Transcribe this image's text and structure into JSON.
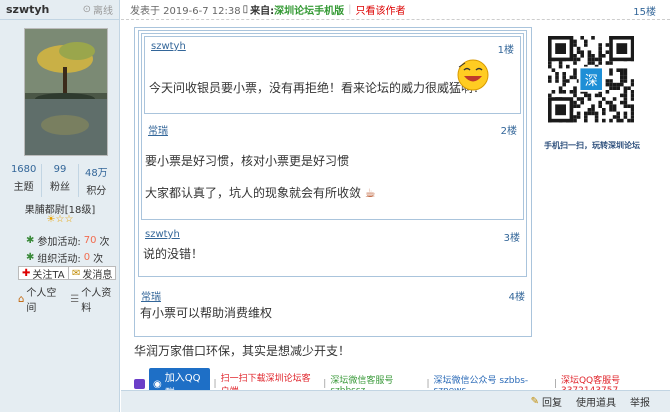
{
  "user": {
    "name": "szwtyh",
    "status": "离线",
    "stats": [
      {
        "value": "1680",
        "label": "主题"
      },
      {
        "value": "99",
        "label": "粉丝"
      },
      {
        "value": "48万",
        "label": "积分"
      }
    ],
    "rank": "果脯都尉[18级]",
    "activities": [
      {
        "prefix": "参加活动:",
        "count": "70",
        "suffix": "次"
      },
      {
        "prefix": "组织活动:",
        "count": "0",
        "suffix": "次"
      }
    ],
    "follow_label": "关注TA",
    "message_label": "发消息",
    "space_label": "个人空间",
    "profile_label": "个人资料"
  },
  "post_header": {
    "posted": "发表于 2019-6-7 12:38",
    "from_label": "来自:",
    "from_source": "深圳论坛手机版",
    "only_author": "只看该作者",
    "floor": "15楼"
  },
  "quotes": [
    {
      "user": "szwtyh",
      "floor": "1楼",
      "lines": [
        "今天问收银员要小票，没有再拒绝！看来论坛的威力很威猛啊！"
      ]
    },
    {
      "user": "常瑞",
      "floor": "2楼",
      "lines": [
        "要小票是好习惯，核对小票更是好习惯",
        "大家都认真了，坑人的现象就会有所收敛"
      ]
    },
    {
      "user": "szwtyh",
      "floor": "3楼",
      "lines": [
        "说的没错！"
      ]
    },
    {
      "user": "常瑞",
      "floor": "4楼",
      "lines": [
        "有小票可以帮助消费维权"
      ]
    }
  ],
  "reply_text": "华润万家借口环保，其实是想减少开支！",
  "signature": {
    "qq_button": "加入QQ群",
    "download": "扫一扫下载深圳论坛客户端",
    "wechat_service": "深坛微信客服号 szbbssz",
    "wechat_public": "深坛微信公众号 szbbs-sznews",
    "qq_service": "深坛QQ客服号 3372143757"
  },
  "qr_caption": "手机扫一扫，玩转深圳论坛",
  "bottom_bar": {
    "reply": "回复",
    "use_tool": "使用道具",
    "report": "举报"
  },
  "colors": {
    "link_blue": "#336699",
    "sidebar_bg": "#e5edf2",
    "border_blue": "#aac4dc",
    "accent_red": "#e0242b",
    "accent_green": "#3a9a3a"
  }
}
